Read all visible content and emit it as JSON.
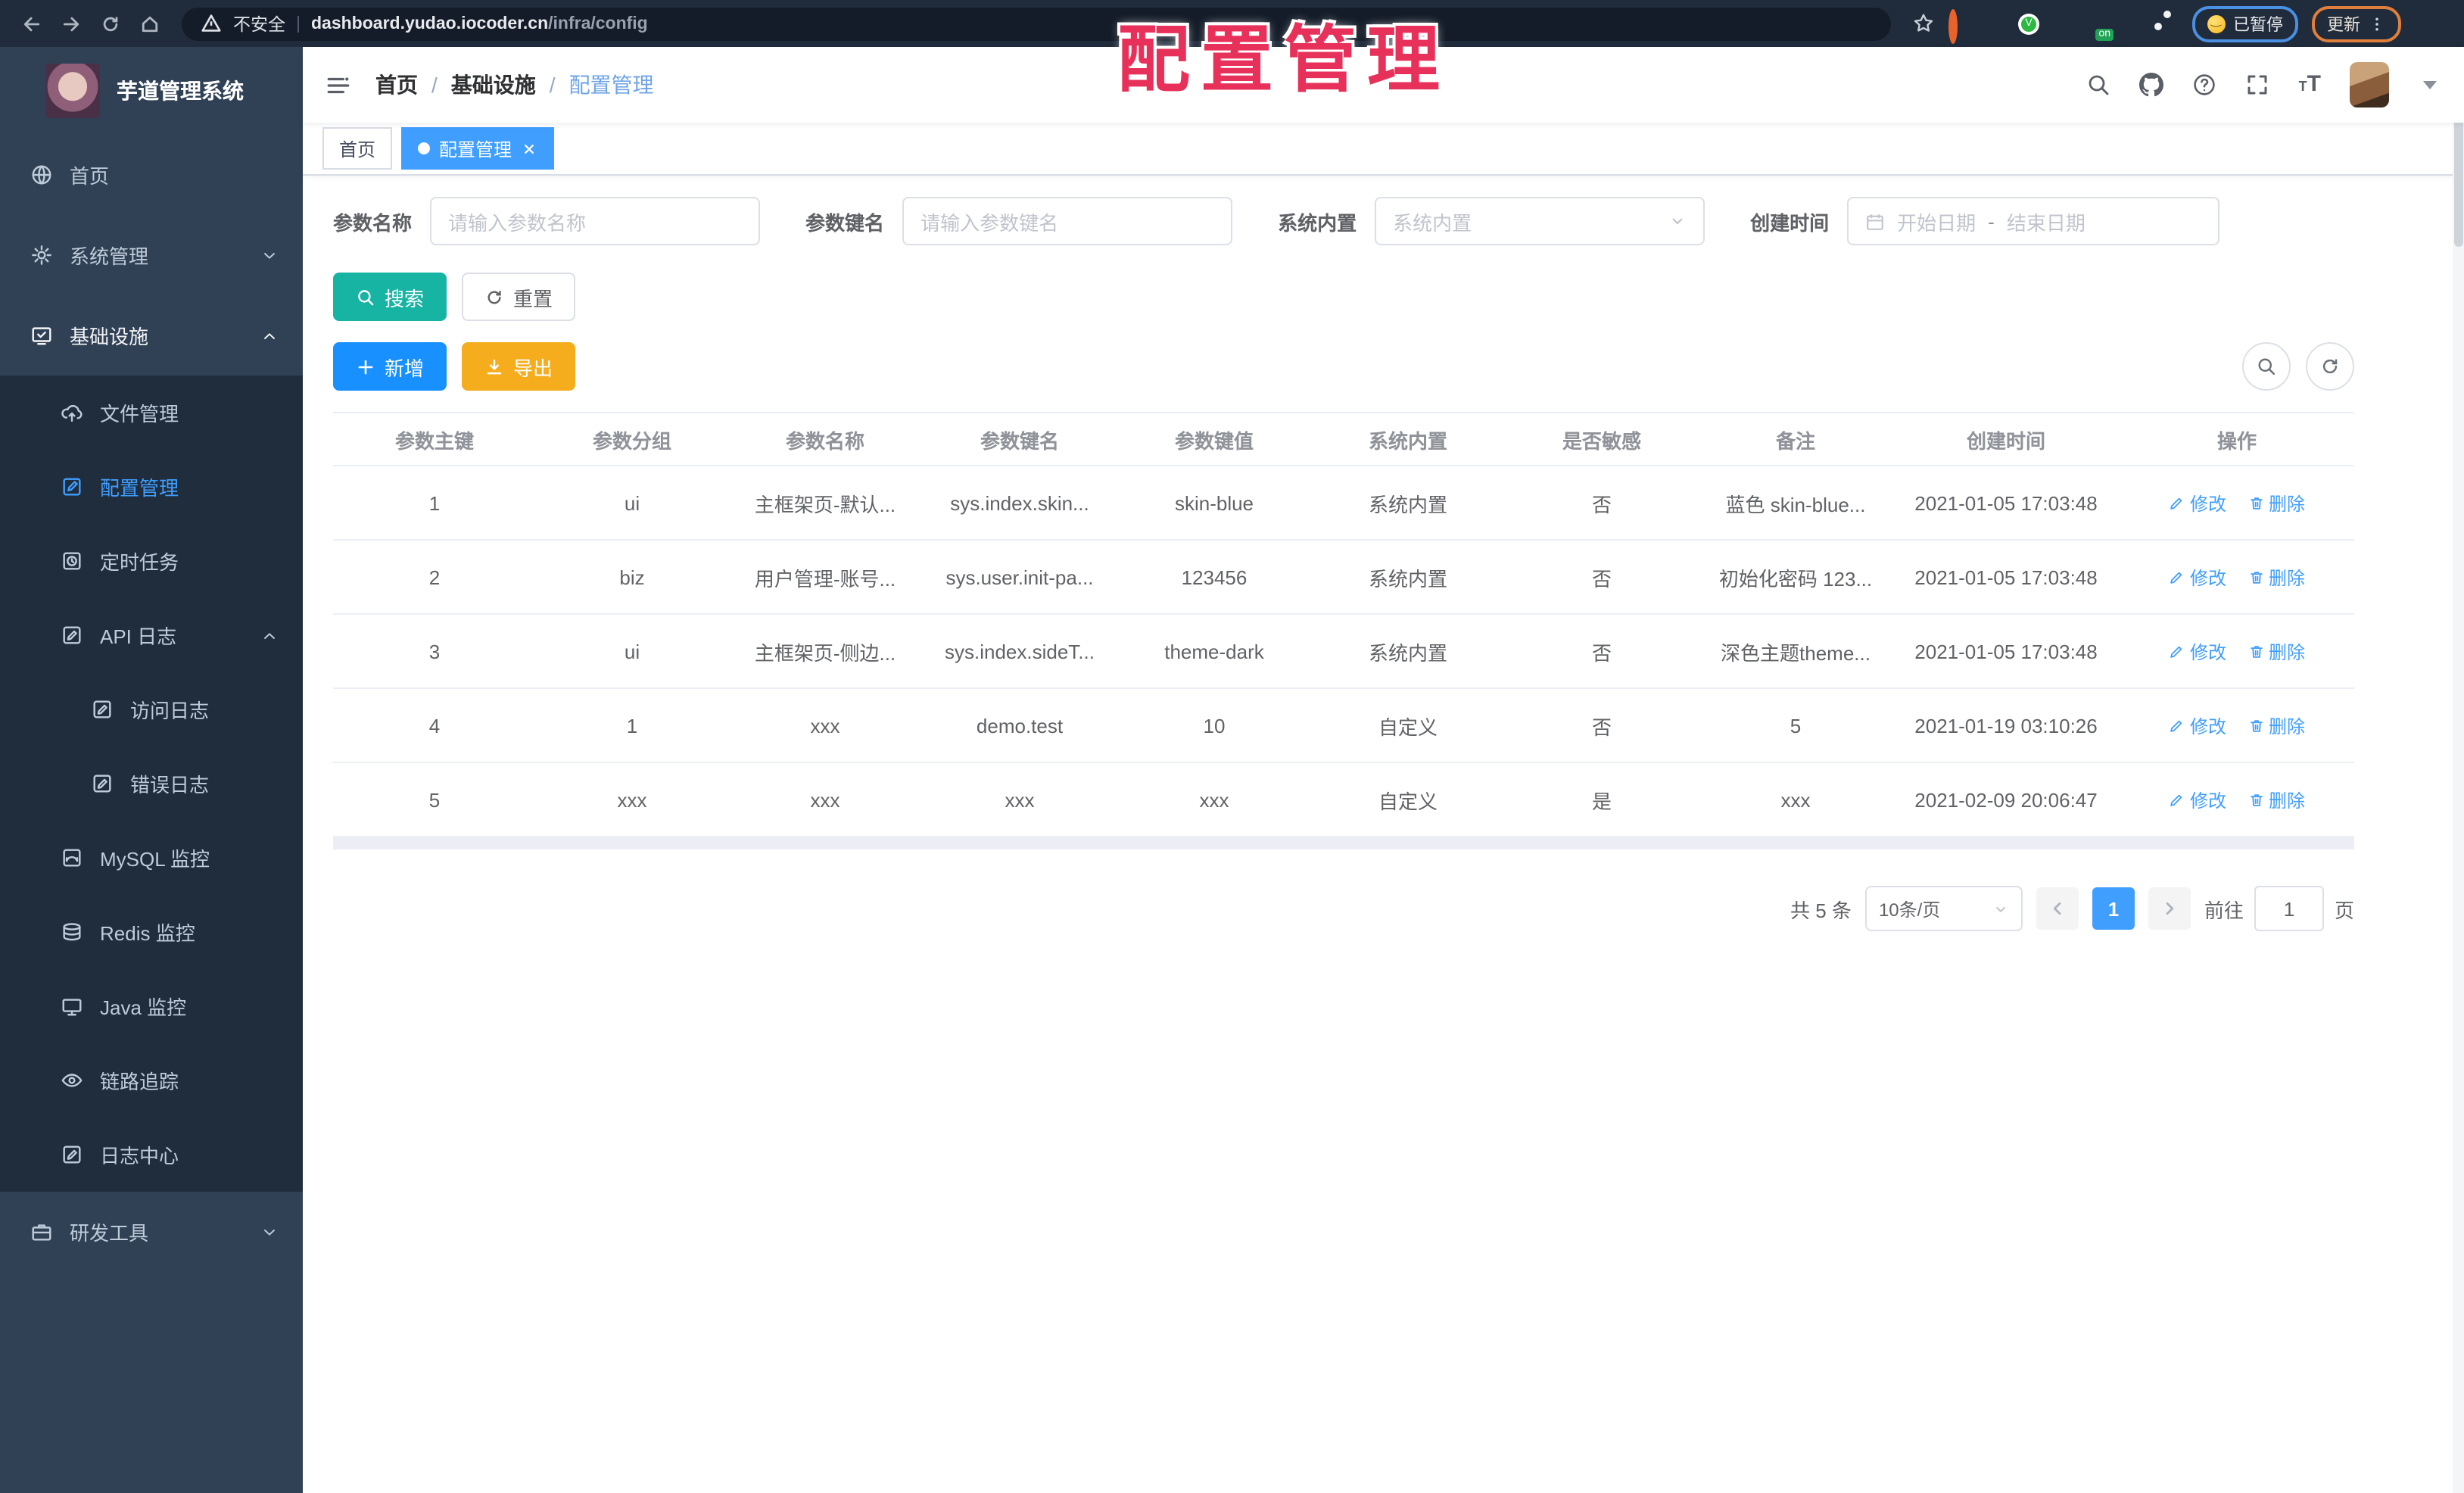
{
  "browser": {
    "security_label": "不安全",
    "url_host": "dashboard.yudao.iocoder.cn",
    "url_path": "/infra/config",
    "url_separator": "|",
    "paused_label": "已暂停",
    "update_label": "更新",
    "icons": [
      "back-icon",
      "forward-icon",
      "reload-icon",
      "home-icon",
      "warning-icon",
      "bookmark-star-icon",
      "orange-ring-extension-icon",
      "blue-pin-extension-icon",
      "green-check-extension-icon",
      "grid-extension-icon",
      "on-badge-extension-icon",
      "green-leaf-extension-icon",
      "puzzle-extension-icon",
      "emoji-face-icon",
      "kebab-menu-icon"
    ]
  },
  "watermark": {
    "text": "配置管理"
  },
  "sidebar": {
    "title": "芋道管理系统",
    "items": [
      {
        "name": "home",
        "label": "首页",
        "icon": "globe-icon",
        "level": 0
      },
      {
        "name": "system",
        "label": "系统管理",
        "icon": "gear-icon",
        "level": 0,
        "chevron": "down"
      },
      {
        "name": "infra",
        "label": "基础设施",
        "icon": "infra-icon",
        "level": 0,
        "chevron": "up",
        "expanded": true
      },
      {
        "name": "file",
        "label": "文件管理",
        "icon": "cloud-upload-icon",
        "level": 1
      },
      {
        "name": "config",
        "label": "配置管理",
        "icon": "edit-square-icon",
        "level": 1,
        "active": true
      },
      {
        "name": "job",
        "label": "定时任务",
        "icon": "schedule-icon",
        "level": 1
      },
      {
        "name": "api-log",
        "label": "API 日志",
        "icon": "doc-pencil-icon",
        "level": 1,
        "chevron": "up"
      },
      {
        "name": "access-log",
        "label": "访问日志",
        "icon": "doc-pencil-icon",
        "level": 2
      },
      {
        "name": "error-log",
        "label": "错误日志",
        "icon": "doc-pencil-icon",
        "level": 2
      },
      {
        "name": "mysql",
        "label": "MySQL 监控",
        "icon": "mysql-icon",
        "level": 1
      },
      {
        "name": "redis",
        "label": "Redis 监控",
        "icon": "redis-icon",
        "level": 1
      },
      {
        "name": "java",
        "label": "Java 监控",
        "icon": "java-icon",
        "level": 1
      },
      {
        "name": "trace",
        "label": "链路追踪",
        "icon": "eye-icon",
        "level": 1
      },
      {
        "name": "log-center",
        "label": "日志中心",
        "icon": "doc-pencil-icon",
        "level": 1
      },
      {
        "name": "devtools",
        "label": "研发工具",
        "icon": "briefcase-icon",
        "level": 0,
        "chevron": "down"
      }
    ]
  },
  "navbar": {
    "breadcrumb": [
      "首页",
      "基础设施",
      "配置管理"
    ],
    "separator": "/"
  },
  "tags": [
    {
      "label": "首页",
      "active": false
    },
    {
      "label": "配置管理",
      "active": true,
      "closable": true
    }
  ],
  "filters": {
    "name_label": "参数名称",
    "name_placeholder": "请输入参数名称",
    "key_label": "参数键名",
    "key_placeholder": "请输入参数键名",
    "builtin_label": "系统内置",
    "builtin_placeholder": "系统内置",
    "date_label": "创建时间",
    "date_start_placeholder": "开始日期",
    "date_separator": "-",
    "date_end_placeholder": "结束日期"
  },
  "toolbar": {
    "search_label": "搜索",
    "reset_label": "重置",
    "add_label": "新增",
    "export_label": "导出"
  },
  "table": {
    "columns": [
      "参数主键",
      "参数分组",
      "参数名称",
      "参数键名",
      "参数键值",
      "系统内置",
      "是否敏感",
      "备注",
      "创建时间",
      "操作"
    ],
    "edit_label": "修改",
    "delete_label": "删除",
    "rows": [
      {
        "cells": [
          "1",
          "ui",
          "主框架页-默认...",
          "sys.index.skin...",
          "skin-blue",
          "系统内置",
          "否",
          "蓝色 skin-blue...",
          "2021-01-05 17:03:48"
        ]
      },
      {
        "cells": [
          "2",
          "biz",
          "用户管理-账号...",
          "sys.user.init-pa...",
          "123456",
          "系统内置",
          "否",
          "初始化密码 123...",
          "2021-01-05 17:03:48"
        ]
      },
      {
        "cells": [
          "3",
          "ui",
          "主框架页-侧边...",
          "sys.index.sideT...",
          "theme-dark",
          "系统内置",
          "否",
          "深色主题theme...",
          "2021-01-05 17:03:48"
        ]
      },
      {
        "cells": [
          "4",
          "1",
          "xxx",
          "demo.test",
          "10",
          "自定义",
          "否",
          "5",
          "2021-01-19 03:10:26"
        ]
      },
      {
        "cells": [
          "5",
          "xxx",
          "xxx",
          "xxx",
          "xxx",
          "自定义",
          "是",
          "xxx",
          "2021-02-09 20:06:47"
        ]
      }
    ]
  },
  "pagination": {
    "total": "共 5 条",
    "page_size": "10条/页",
    "current_page": "1",
    "goto_label": "前往",
    "goto_value": "1",
    "page_unit": "页"
  },
  "colors": {
    "primary": "#409eff",
    "tag_active": "#409eff",
    "search_button": "#17b3a3",
    "add_button": "#1890ff",
    "export_button": "#f5ad1e",
    "link": "#409eff",
    "watermark": "#e8315a",
    "sidebar_bg": "#304156",
    "submenu_bg": "#1f2d3d"
  }
}
